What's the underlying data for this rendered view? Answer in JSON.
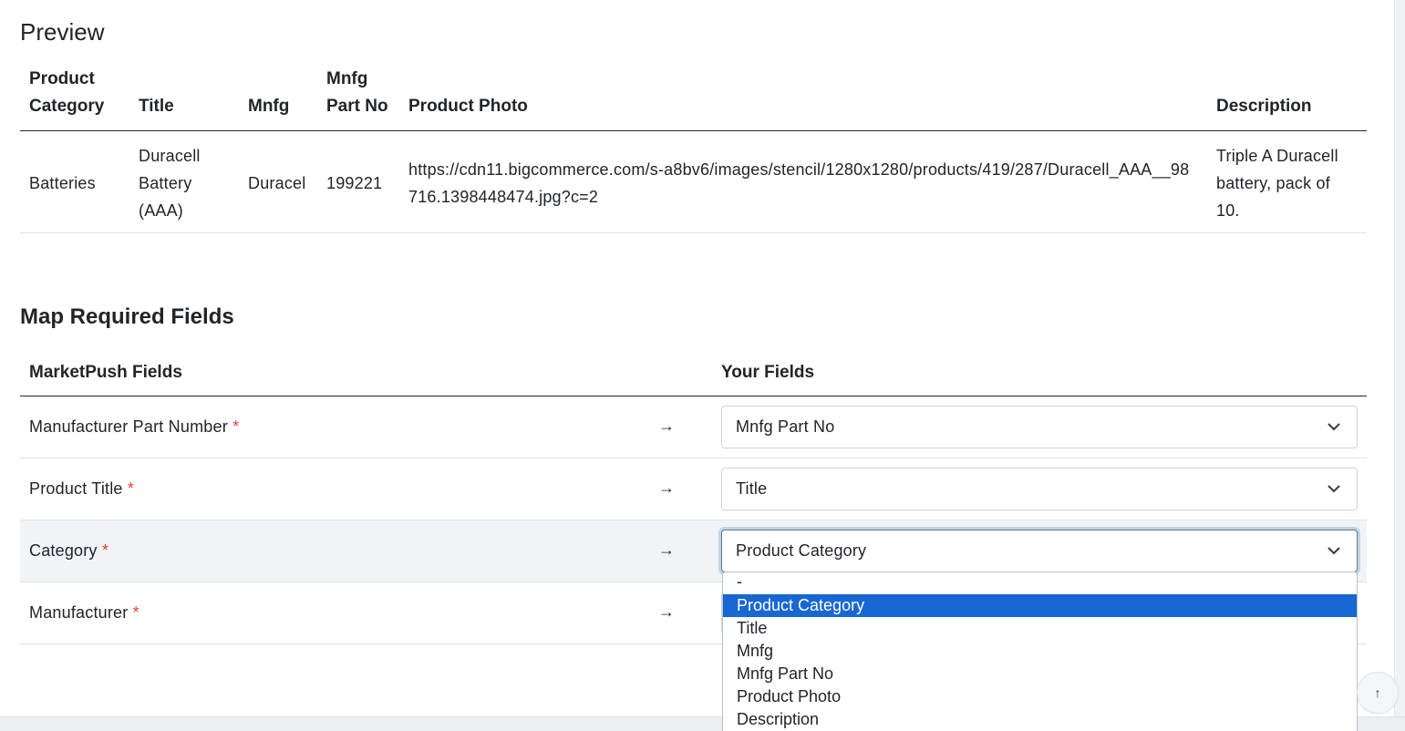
{
  "preview": {
    "title": "Preview",
    "headers": [
      "Product Category",
      "Title",
      "Mnfg",
      "Mnfg Part No",
      "Product Photo",
      "Description"
    ],
    "row": {
      "category": "Batteries",
      "title": "Duracell Battery (AAA)",
      "mnfg": "Duracel",
      "part_no": "199221",
      "photo": "https://cdn11.bigcommerce.com/s-a8bv6/images/stencil/1280x1280/products/419/287/Duracell_AAA__98716.1398448474.jpg?c=2",
      "description": "Triple A Duracell battery, pack of 10."
    }
  },
  "mapping": {
    "title": "Map Required Fields",
    "col_marketpush": "MarketPush Fields",
    "col_yours": "Your Fields",
    "required_mark": "*",
    "arrow": "→",
    "rows": [
      {
        "field": "Manufacturer Part Number",
        "value": "Mnfg Part No"
      },
      {
        "field": "Product Title",
        "value": "Title"
      },
      {
        "field": "Category",
        "value": "Product Category"
      },
      {
        "field": "Manufacturer",
        "value": ""
      }
    ]
  },
  "dropdown": {
    "options": [
      "-",
      "Product Category",
      "Title",
      "Mnfg",
      "Mnfg Part No",
      "Product Photo",
      "Description"
    ],
    "selected": "Product Category"
  },
  "scroll_top": {
    "icon": "arrow-up-icon",
    "glyph": "↑"
  }
}
